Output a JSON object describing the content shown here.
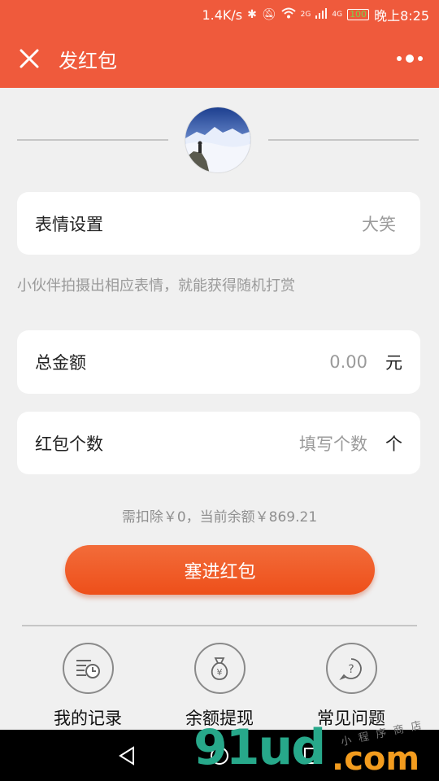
{
  "status": {
    "speed": "1.4K/s",
    "net_2g": "2G",
    "net_4g": "4G",
    "battery": "100",
    "time": "晚上8:25"
  },
  "header": {
    "title": "发红包"
  },
  "expression": {
    "label": "表情设置",
    "value": "大笑"
  },
  "hint": "小伙伴拍摄出相应表情，就能获得随机打赏",
  "amount": {
    "label": "总金额",
    "value": "0.00",
    "unit": "元"
  },
  "count": {
    "label": "红包个数",
    "placeholder": "填写个数",
    "unit": "个"
  },
  "balance_text": "需扣除￥0，当前余额￥869.21",
  "submit_label": "塞进红包",
  "tools": [
    {
      "label": "我的记录",
      "icon": "records-icon"
    },
    {
      "label": "余额提现",
      "icon": "money-bag-icon"
    },
    {
      "label": "常见问题",
      "icon": "faq-icon"
    }
  ],
  "watermark": {
    "main": "91ud",
    "suffix": ".com",
    "small": "小程序商店"
  },
  "colors": {
    "header": "#ef5a3c",
    "button": "#ee4f1a",
    "background": "#f0f0f0"
  }
}
